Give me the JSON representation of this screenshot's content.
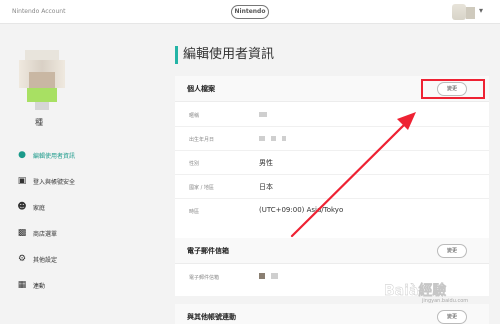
{
  "header": {
    "account_title": "Nintendo Account",
    "logo_text": "Nintendo"
  },
  "sidebar": {
    "profile_name": "種",
    "items": [
      {
        "label": "編輯使用者資訊",
        "icon": "person-icon",
        "active": true
      },
      {
        "label": "登入與帳號安全",
        "icon": "lock-icon",
        "active": false
      },
      {
        "label": "家庭",
        "icon": "family-icon",
        "active": false
      },
      {
        "label": "商店選單",
        "icon": "shop-icon",
        "active": false
      },
      {
        "label": "其他設定",
        "icon": "gear-icon",
        "active": false
      },
      {
        "label": "連動",
        "icon": "grid-icon",
        "active": false
      }
    ]
  },
  "main": {
    "page_title": "編輯使用者資訊",
    "profile_card": {
      "title": "個人檔案",
      "edit_label": "變更",
      "rows": [
        {
          "label": "暱稱",
          "value": ""
        },
        {
          "label": "出生年月日",
          "value": ""
        },
        {
          "label": "性別",
          "value": "男性"
        },
        {
          "label": "國家 / 地區",
          "value": "日本"
        },
        {
          "label": "時區",
          "value": "(UTC+09:00) Asia/Tokyo"
        }
      ]
    },
    "email_card": {
      "title": "電子郵件信箱",
      "edit_label": "變更",
      "rows": [
        {
          "label": "電子郵件信箱",
          "value": ""
        }
      ]
    },
    "link_card": {
      "title": "與其他帳號連動",
      "edit_label": "變更"
    }
  },
  "watermark": {
    "brand": "Baià經驗",
    "url": "jingyan.baidu.com"
  },
  "colors": {
    "accent": "#23b4a6",
    "annotation": "#ee2233"
  }
}
